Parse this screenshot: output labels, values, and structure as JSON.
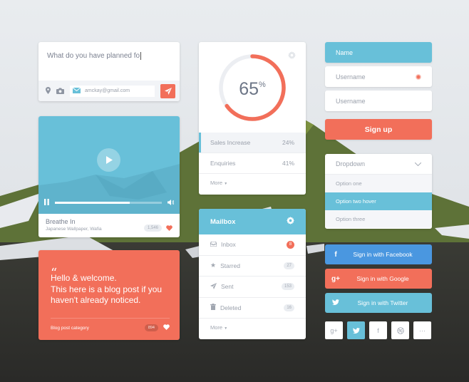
{
  "composer": {
    "text": "What do you have planned fo",
    "email": "amckay@gmail.com",
    "icons": [
      "location-icon",
      "camera-icon",
      "mail-icon",
      "send-icon"
    ]
  },
  "video": {
    "title": "Breathe In",
    "subtitle": "Japanese Wallpaper, Wafia",
    "likes": "1,546",
    "progress_fraction": 0.7
  },
  "blog": {
    "quote_mark": "“",
    "line1": "Hello & welcome.",
    "line2": "This here is a blog post if you haven't already noticed.",
    "category": "Blog post category",
    "likes": "894"
  },
  "stats": {
    "percent_value": 65,
    "percent_label": "65",
    "percent_sign": "%",
    "rows": [
      {
        "label": "Sales Increase",
        "value": "24%"
      },
      {
        "label": "Enquiries",
        "value": "41%"
      }
    ],
    "more": "More"
  },
  "mailbox": {
    "title": "Mailbox",
    "items": [
      {
        "label": "Inbox",
        "count": "8",
        "icon": "inbox-icon"
      },
      {
        "label": "Starred",
        "count": "27",
        "icon": "star-icon"
      },
      {
        "label": "Sent",
        "count": "153",
        "icon": "send-icon"
      },
      {
        "label": "Deleted",
        "count": "16",
        "icon": "trash-icon"
      }
    ],
    "more": "More"
  },
  "form": {
    "name": "Name",
    "username1": "Username",
    "username2": "Username",
    "signup": "Sign up"
  },
  "dropdown": {
    "label": "Dropdown",
    "options": [
      "Option one",
      "Option two hover",
      "Option three"
    ]
  },
  "social": {
    "facebook": "Sign in with Facebook",
    "google": "Sign in with Google",
    "twitter": "Sign in with Twitter",
    "square_icons": [
      "google-plus-icon",
      "twitter-icon",
      "facebook-icon",
      "dribbble-icon",
      "more-icon"
    ]
  },
  "colors": {
    "accent_blue": "#68c0d9",
    "accent_coral": "#f26f5a",
    "facebook_blue": "#4a97e0"
  }
}
